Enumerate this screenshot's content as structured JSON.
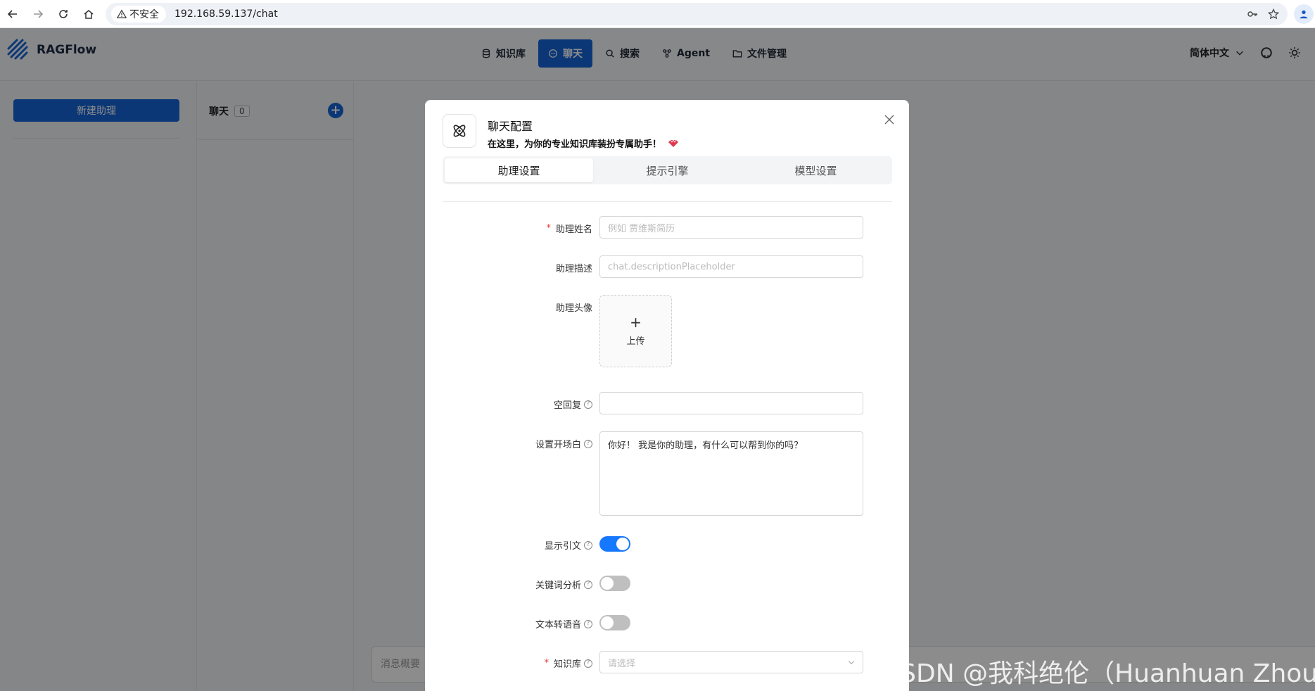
{
  "browser": {
    "security_label": "不安全",
    "url": "192.168.59.137/chat"
  },
  "app": {
    "brand": "RAGFlow",
    "nav": [
      {
        "label": "知识库",
        "icon": "database-icon"
      },
      {
        "label": "聊天",
        "icon": "chat-icon",
        "active": true
      },
      {
        "label": "搜索",
        "icon": "search-icon"
      },
      {
        "label": "Agent",
        "icon": "agent-icon"
      },
      {
        "label": "文件管理",
        "icon": "folder-icon"
      }
    ],
    "language": "简体中文",
    "accent_color": "#1565d8"
  },
  "sidebar": {
    "new_assistant_label": "新建助理"
  },
  "chat_list": {
    "title": "聊天",
    "count": "0"
  },
  "chat_main": {
    "message_placeholder": "消息概要"
  },
  "modal": {
    "title": "聊天配置",
    "subtitle": "在这里，为你的专业知识库装扮专属助手！",
    "tabs": [
      {
        "label": "助理设置",
        "active": true
      },
      {
        "label": "提示引擎",
        "active": false
      },
      {
        "label": "模型设置",
        "active": false
      }
    ],
    "fields": {
      "name": {
        "label": "助理姓名",
        "required": true,
        "placeholder": "例如 贾维斯简历"
      },
      "description": {
        "label": "助理描述",
        "placeholder": "chat.descriptionPlaceholder"
      },
      "avatar": {
        "label": "助理头像",
        "upload_label": "上传"
      },
      "empty_response": {
        "label": "空回复",
        "value": ""
      },
      "opener": {
        "label": "设置开场白",
        "value": "你好！ 我是你的助理，有什么可以帮到你的吗？"
      },
      "show_quote": {
        "label": "显示引文",
        "on": true
      },
      "keyword": {
        "label": "关键词分析",
        "on": false
      },
      "tts": {
        "label": "文本转语音",
        "on": false
      },
      "knowledge_base": {
        "label": "知识库",
        "required": true,
        "placeholder": "请选择"
      }
    }
  },
  "watermark": "CSDN @我科绝伦（Huanhuan Zhou）"
}
